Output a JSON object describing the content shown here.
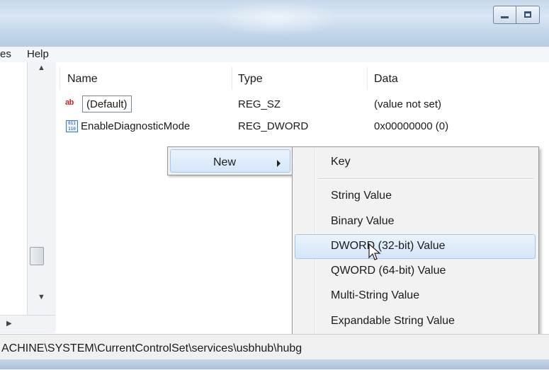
{
  "menubar": {
    "items": [
      "es",
      "Help"
    ]
  },
  "list": {
    "columns": [
      "Name",
      "Type",
      "Data"
    ],
    "rows": [
      {
        "name": "(Default)",
        "type": "REG_SZ",
        "data": "(value not set)",
        "icon": "string-value-icon",
        "icon_text": "ab"
      },
      {
        "name": "EnableDiagnosticMode",
        "type": "REG_DWORD",
        "data": "0x00000000 (0)",
        "icon": "binary-value-icon",
        "icon_text": "011 110"
      }
    ]
  },
  "context_menu": {
    "new_label": "New"
  },
  "submenu": {
    "items": [
      "Key",
      "String Value",
      "Binary Value",
      "DWORD (32-bit) Value",
      "QWORD (64-bit) Value",
      "Multi-String Value",
      "Expandable String Value"
    ],
    "highlighted": "DWORD (32-bit) Value"
  },
  "status": {
    "path": "ACHINE\\SYSTEM\\CurrentControlSet\\services\\usbhub\\hubg"
  },
  "colors": {
    "highlight": "#d4e6f9",
    "highlight_border": "#a8c6ea",
    "title_bar": "#c7d8ea"
  }
}
